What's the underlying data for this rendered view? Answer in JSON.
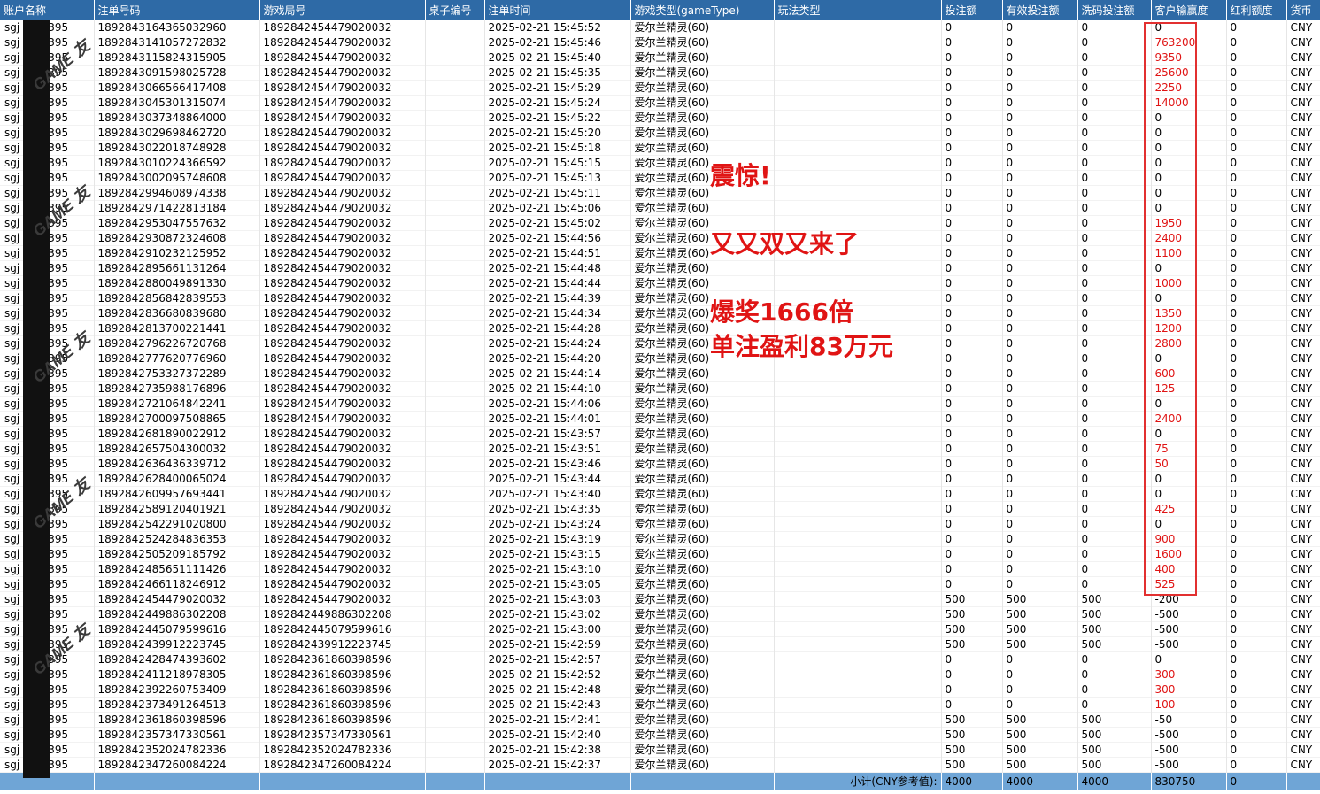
{
  "headers": [
    "账户名称",
    "注单号码",
    "游戏局号",
    "桌子编号",
    "注单时间",
    "游戏类型(gameType)",
    "玩法类型",
    "投注额",
    "有效投注额",
    "洗码投注额",
    "客户输赢度",
    "红利额度",
    "货币"
  ],
  "rows": [
    {
      "acct": "sgj",
      "acct_tail": "395",
      "bet_no": "1892843164365032960",
      "round": "1892842454479020032",
      "table": "",
      "time": "2025-02-21 15:45:52",
      "game": "爱尔兰精灵(60)",
      "play": "",
      "bet": "0",
      "valid": "0",
      "wash": "0",
      "win": "0",
      "bonus": "0",
      "cur": "CNY"
    },
    {
      "acct": "sgj",
      "acct_tail": "395",
      "bet_no": "1892843141057272832",
      "round": "1892842454479020032",
      "table": "",
      "time": "2025-02-21 15:45:46",
      "game": "爱尔兰精灵(60)",
      "play": "",
      "bet": "0",
      "valid": "0",
      "wash": "0",
      "win": "763200",
      "bonus": "0",
      "cur": "CNY"
    },
    {
      "acct": "sgj",
      "acct_tail": "395",
      "bet_no": "1892843115824315905",
      "round": "1892842454479020032",
      "table": "",
      "time": "2025-02-21 15:45:40",
      "game": "爱尔兰精灵(60)",
      "play": "",
      "bet": "0",
      "valid": "0",
      "wash": "0",
      "win": "9350",
      "bonus": "0",
      "cur": "CNY"
    },
    {
      "acct": "sgj",
      "acct_tail": "395",
      "bet_no": "1892843091598025728",
      "round": "1892842454479020032",
      "table": "",
      "time": "2025-02-21 15:45:35",
      "game": "爱尔兰精灵(60)",
      "play": "",
      "bet": "0",
      "valid": "0",
      "wash": "0",
      "win": "25600",
      "bonus": "0",
      "cur": "CNY"
    },
    {
      "acct": "sgj",
      "acct_tail": "395",
      "bet_no": "1892843066566417408",
      "round": "1892842454479020032",
      "table": "",
      "time": "2025-02-21 15:45:29",
      "game": "爱尔兰精灵(60)",
      "play": "",
      "bet": "0",
      "valid": "0",
      "wash": "0",
      "win": "2250",
      "bonus": "0",
      "cur": "CNY"
    },
    {
      "acct": "sgj",
      "acct_tail": "395",
      "bet_no": "1892843045301315074",
      "round": "1892842454479020032",
      "table": "",
      "time": "2025-02-21 15:45:24",
      "game": "爱尔兰精灵(60)",
      "play": "",
      "bet": "0",
      "valid": "0",
      "wash": "0",
      "win": "14000",
      "bonus": "0",
      "cur": "CNY"
    },
    {
      "acct": "sgj",
      "acct_tail": "395",
      "bet_no": "1892843037348864000",
      "round": "1892842454479020032",
      "table": "",
      "time": "2025-02-21 15:45:22",
      "game": "爱尔兰精灵(60)",
      "play": "",
      "bet": "0",
      "valid": "0",
      "wash": "0",
      "win": "0",
      "bonus": "0",
      "cur": "CNY"
    },
    {
      "acct": "sgj",
      "acct_tail": "395",
      "bet_no": "1892843029698462720",
      "round": "1892842454479020032",
      "table": "",
      "time": "2025-02-21 15:45:20",
      "game": "爱尔兰精灵(60)",
      "play": "",
      "bet": "0",
      "valid": "0",
      "wash": "0",
      "win": "0",
      "bonus": "0",
      "cur": "CNY"
    },
    {
      "acct": "sgj",
      "acct_tail": "395",
      "bet_no": "1892843022018748928",
      "round": "1892842454479020032",
      "table": "",
      "time": "2025-02-21 15:45:18",
      "game": "爱尔兰精灵(60)",
      "play": "",
      "bet": "0",
      "valid": "0",
      "wash": "0",
      "win": "0",
      "bonus": "0",
      "cur": "CNY"
    },
    {
      "acct": "sgj",
      "acct_tail": "395",
      "bet_no": "1892843010224366592",
      "round": "1892842454479020032",
      "table": "",
      "time": "2025-02-21 15:45:15",
      "game": "爱尔兰精灵(60)",
      "play": "",
      "bet": "0",
      "valid": "0",
      "wash": "0",
      "win": "0",
      "bonus": "0",
      "cur": "CNY"
    },
    {
      "acct": "sgj",
      "acct_tail": "395",
      "bet_no": "1892843002095748608",
      "round": "1892842454479020032",
      "table": "",
      "time": "2025-02-21 15:45:13",
      "game": "爱尔兰精灵(60)",
      "play": "",
      "bet": "0",
      "valid": "0",
      "wash": "0",
      "win": "0",
      "bonus": "0",
      "cur": "CNY"
    },
    {
      "acct": "sgj",
      "acct_tail": "395",
      "bet_no": "1892842994608974338",
      "round": "1892842454479020032",
      "table": "",
      "time": "2025-02-21 15:45:11",
      "game": "爱尔兰精灵(60)",
      "play": "",
      "bet": "0",
      "valid": "0",
      "wash": "0",
      "win": "0",
      "bonus": "0",
      "cur": "CNY"
    },
    {
      "acct": "sgj",
      "acct_tail": "395",
      "bet_no": "1892842971422813184",
      "round": "1892842454479020032",
      "table": "",
      "time": "2025-02-21 15:45:06",
      "game": "爱尔兰精灵(60)",
      "play": "",
      "bet": "0",
      "valid": "0",
      "wash": "0",
      "win": "0",
      "bonus": "0",
      "cur": "CNY"
    },
    {
      "acct": "sgj",
      "acct_tail": "395",
      "bet_no": "1892842953047557632",
      "round": "1892842454479020032",
      "table": "",
      "time": "2025-02-21 15:45:02",
      "game": "爱尔兰精灵(60)",
      "play": "",
      "bet": "0",
      "valid": "0",
      "wash": "0",
      "win": "1950",
      "bonus": "0",
      "cur": "CNY"
    },
    {
      "acct": "sgj",
      "acct_tail": "395",
      "bet_no": "1892842930872324608",
      "round": "1892842454479020032",
      "table": "",
      "time": "2025-02-21 15:44:56",
      "game": "爱尔兰精灵(60)",
      "play": "",
      "bet": "0",
      "valid": "0",
      "wash": "0",
      "win": "2400",
      "bonus": "0",
      "cur": "CNY"
    },
    {
      "acct": "sgj",
      "acct_tail": "395",
      "bet_no": "1892842910232125952",
      "round": "1892842454479020032",
      "table": "",
      "time": "2025-02-21 15:44:51",
      "game": "爱尔兰精灵(60)",
      "play": "",
      "bet": "0",
      "valid": "0",
      "wash": "0",
      "win": "1100",
      "bonus": "0",
      "cur": "CNY"
    },
    {
      "acct": "sgj",
      "acct_tail": "395",
      "bet_no": "1892842895661131264",
      "round": "1892842454479020032",
      "table": "",
      "time": "2025-02-21 15:44:48",
      "game": "爱尔兰精灵(60)",
      "play": "",
      "bet": "0",
      "valid": "0",
      "wash": "0",
      "win": "0",
      "bonus": "0",
      "cur": "CNY"
    },
    {
      "acct": "sgj",
      "acct_tail": "395",
      "bet_no": "1892842880049891330",
      "round": "1892842454479020032",
      "table": "",
      "time": "2025-02-21 15:44:44",
      "game": "爱尔兰精灵(60)",
      "play": "",
      "bet": "0",
      "valid": "0",
      "wash": "0",
      "win": "1000",
      "bonus": "0",
      "cur": "CNY"
    },
    {
      "acct": "sgj",
      "acct_tail": "395",
      "bet_no": "1892842856842839553",
      "round": "1892842454479020032",
      "table": "",
      "time": "2025-02-21 15:44:39",
      "game": "爱尔兰精灵(60)",
      "play": "",
      "bet": "0",
      "valid": "0",
      "wash": "0",
      "win": "0",
      "bonus": "0",
      "cur": "CNY"
    },
    {
      "acct": "sgj",
      "acct_tail": "395",
      "bet_no": "1892842836680839680",
      "round": "1892842454479020032",
      "table": "",
      "time": "2025-02-21 15:44:34",
      "game": "爱尔兰精灵(60)",
      "play": "",
      "bet": "0",
      "valid": "0",
      "wash": "0",
      "win": "1350",
      "bonus": "0",
      "cur": "CNY"
    },
    {
      "acct": "sgj",
      "acct_tail": "395",
      "bet_no": "1892842813700221441",
      "round": "1892842454479020032",
      "table": "",
      "time": "2025-02-21 15:44:28",
      "game": "爱尔兰精灵(60)",
      "play": "",
      "bet": "0",
      "valid": "0",
      "wash": "0",
      "win": "1200",
      "bonus": "0",
      "cur": "CNY"
    },
    {
      "acct": "sgj",
      "acct_tail": "395",
      "bet_no": "1892842796226720768",
      "round": "1892842454479020032",
      "table": "",
      "time": "2025-02-21 15:44:24",
      "game": "爱尔兰精灵(60)",
      "play": "",
      "bet": "0",
      "valid": "0",
      "wash": "0",
      "win": "2800",
      "bonus": "0",
      "cur": "CNY"
    },
    {
      "acct": "sgj",
      "acct_tail": "395",
      "bet_no": "1892842777620776960",
      "round": "1892842454479020032",
      "table": "",
      "time": "2025-02-21 15:44:20",
      "game": "爱尔兰精灵(60)",
      "play": "",
      "bet": "0",
      "valid": "0",
      "wash": "0",
      "win": "0",
      "bonus": "0",
      "cur": "CNY"
    },
    {
      "acct": "sgj",
      "acct_tail": "395",
      "bet_no": "1892842753327372289",
      "round": "1892842454479020032",
      "table": "",
      "time": "2025-02-21 15:44:14",
      "game": "爱尔兰精灵(60)",
      "play": "",
      "bet": "0",
      "valid": "0",
      "wash": "0",
      "win": "600",
      "bonus": "0",
      "cur": "CNY"
    },
    {
      "acct": "sgj",
      "acct_tail": "395",
      "bet_no": "1892842735988176896",
      "round": "1892842454479020032",
      "table": "",
      "time": "2025-02-21 15:44:10",
      "game": "爱尔兰精灵(60)",
      "play": "",
      "bet": "0",
      "valid": "0",
      "wash": "0",
      "win": "125",
      "bonus": "0",
      "cur": "CNY"
    },
    {
      "acct": "sgj",
      "acct_tail": "395",
      "bet_no": "1892842721064842241",
      "round": "1892842454479020032",
      "table": "",
      "time": "2025-02-21 15:44:06",
      "game": "爱尔兰精灵(60)",
      "play": "",
      "bet": "0",
      "valid": "0",
      "wash": "0",
      "win": "0",
      "bonus": "0",
      "cur": "CNY"
    },
    {
      "acct": "sgj",
      "acct_tail": "395",
      "bet_no": "1892842700097508865",
      "round": "1892842454479020032",
      "table": "",
      "time": "2025-02-21 15:44:01",
      "game": "爱尔兰精灵(60)",
      "play": "",
      "bet": "0",
      "valid": "0",
      "wash": "0",
      "win": "2400",
      "bonus": "0",
      "cur": "CNY"
    },
    {
      "acct": "sgj",
      "acct_tail": "395",
      "bet_no": "1892842681890022912",
      "round": "1892842454479020032",
      "table": "",
      "time": "2025-02-21 15:43:57",
      "game": "爱尔兰精灵(60)",
      "play": "",
      "bet": "0",
      "valid": "0",
      "wash": "0",
      "win": "0",
      "bonus": "0",
      "cur": "CNY"
    },
    {
      "acct": "sgj",
      "acct_tail": "395",
      "bet_no": "1892842657504300032",
      "round": "1892842454479020032",
      "table": "",
      "time": "2025-02-21 15:43:51",
      "game": "爱尔兰精灵(60)",
      "play": "",
      "bet": "0",
      "valid": "0",
      "wash": "0",
      "win": "75",
      "bonus": "0",
      "cur": "CNY"
    },
    {
      "acct": "sgj",
      "acct_tail": "395",
      "bet_no": "1892842636436339712",
      "round": "1892842454479020032",
      "table": "",
      "time": "2025-02-21 15:43:46",
      "game": "爱尔兰精灵(60)",
      "play": "",
      "bet": "0",
      "valid": "0",
      "wash": "0",
      "win": "50",
      "bonus": "0",
      "cur": "CNY"
    },
    {
      "acct": "sgj",
      "acct_tail": "395",
      "bet_no": "1892842628400065024",
      "round": "1892842454479020032",
      "table": "",
      "time": "2025-02-21 15:43:44",
      "game": "爱尔兰精灵(60)",
      "play": "",
      "bet": "0",
      "valid": "0",
      "wash": "0",
      "win": "0",
      "bonus": "0",
      "cur": "CNY"
    },
    {
      "acct": "sgj",
      "acct_tail": "395",
      "bet_no": "1892842609957693441",
      "round": "1892842454479020032",
      "table": "",
      "time": "2025-02-21 15:43:40",
      "game": "爱尔兰精灵(60)",
      "play": "",
      "bet": "0",
      "valid": "0",
      "wash": "0",
      "win": "0",
      "bonus": "0",
      "cur": "CNY"
    },
    {
      "acct": "sgj",
      "acct_tail": "395",
      "bet_no": "1892842589120401921",
      "round": "1892842454479020032",
      "table": "",
      "time": "2025-02-21 15:43:35",
      "game": "爱尔兰精灵(60)",
      "play": "",
      "bet": "0",
      "valid": "0",
      "wash": "0",
      "win": "425",
      "bonus": "0",
      "cur": "CNY"
    },
    {
      "acct": "sgj",
      "acct_tail": "395",
      "bet_no": "1892842542291020800",
      "round": "1892842454479020032",
      "table": "",
      "time": "2025-02-21 15:43:24",
      "game": "爱尔兰精灵(60)",
      "play": "",
      "bet": "0",
      "valid": "0",
      "wash": "0",
      "win": "0",
      "bonus": "0",
      "cur": "CNY"
    },
    {
      "acct": "sgj",
      "acct_tail": "395",
      "bet_no": "1892842524284836353",
      "round": "1892842454479020032",
      "table": "",
      "time": "2025-02-21 15:43:19",
      "game": "爱尔兰精灵(60)",
      "play": "",
      "bet": "0",
      "valid": "0",
      "wash": "0",
      "win": "900",
      "bonus": "0",
      "cur": "CNY"
    },
    {
      "acct": "sgj",
      "acct_tail": "395",
      "bet_no": "1892842505209185792",
      "round": "1892842454479020032",
      "table": "",
      "time": "2025-02-21 15:43:15",
      "game": "爱尔兰精灵(60)",
      "play": "",
      "bet": "0",
      "valid": "0",
      "wash": "0",
      "win": "1600",
      "bonus": "0",
      "cur": "CNY"
    },
    {
      "acct": "sgj",
      "acct_tail": "395",
      "bet_no": "1892842485651111426",
      "round": "1892842454479020032",
      "table": "",
      "time": "2025-02-21 15:43:10",
      "game": "爱尔兰精灵(60)",
      "play": "",
      "bet": "0",
      "valid": "0",
      "wash": "0",
      "win": "400",
      "bonus": "0",
      "cur": "CNY"
    },
    {
      "acct": "sgj",
      "acct_tail": "395",
      "bet_no": "1892842466118246912",
      "round": "1892842454479020032",
      "table": "",
      "time": "2025-02-21 15:43:05",
      "game": "爱尔兰精灵(60)",
      "play": "",
      "bet": "0",
      "valid": "0",
      "wash": "0",
      "win": "525",
      "bonus": "0",
      "cur": "CNY"
    },
    {
      "acct": "sgj",
      "acct_tail": "395",
      "bet_no": "1892842454479020032",
      "round": "1892842454479020032",
      "table": "",
      "time": "2025-02-21 15:43:03",
      "game": "爱尔兰精灵(60)",
      "play": "",
      "bet": "500",
      "valid": "500",
      "wash": "500",
      "win": "-200",
      "bonus": "0",
      "cur": "CNY"
    },
    {
      "acct": "sgj",
      "acct_tail": "395",
      "bet_no": "1892842449886302208",
      "round": "1892842449886302208",
      "table": "",
      "time": "2025-02-21 15:43:02",
      "game": "爱尔兰精灵(60)",
      "play": "",
      "bet": "500",
      "valid": "500",
      "wash": "500",
      "win": "-500",
      "bonus": "0",
      "cur": "CNY"
    },
    {
      "acct": "sgj",
      "acct_tail": "395",
      "bet_no": "1892842445079599616",
      "round": "1892842445079599616",
      "table": "",
      "time": "2025-02-21 15:43:00",
      "game": "爱尔兰精灵(60)",
      "play": "",
      "bet": "500",
      "valid": "500",
      "wash": "500",
      "win": "-500",
      "bonus": "0",
      "cur": "CNY"
    },
    {
      "acct": "sgj",
      "acct_tail": "395",
      "bet_no": "1892842439912223745",
      "round": "1892842439912223745",
      "table": "",
      "time": "2025-02-21 15:42:59",
      "game": "爱尔兰精灵(60)",
      "play": "",
      "bet": "500",
      "valid": "500",
      "wash": "500",
      "win": "-500",
      "bonus": "0",
      "cur": "CNY"
    },
    {
      "acct": "sgj",
      "acct_tail": "395",
      "bet_no": "1892842428474393602",
      "round": "1892842361860398596",
      "table": "",
      "time": "2025-02-21 15:42:57",
      "game": "爱尔兰精灵(60)",
      "play": "",
      "bet": "0",
      "valid": "0",
      "wash": "0",
      "win": "0",
      "bonus": "0",
      "cur": "CNY"
    },
    {
      "acct": "sgj",
      "acct_tail": "395",
      "bet_no": "1892842411218978305",
      "round": "1892842361860398596",
      "table": "",
      "time": "2025-02-21 15:42:52",
      "game": "爱尔兰精灵(60)",
      "play": "",
      "bet": "0",
      "valid": "0",
      "wash": "0",
      "win": "300",
      "bonus": "0",
      "cur": "CNY"
    },
    {
      "acct": "sgj",
      "acct_tail": "395",
      "bet_no": "1892842392260753409",
      "round": "1892842361860398596",
      "table": "",
      "time": "2025-02-21 15:42:48",
      "game": "爱尔兰精灵(60)",
      "play": "",
      "bet": "0",
      "valid": "0",
      "wash": "0",
      "win": "300",
      "bonus": "0",
      "cur": "CNY"
    },
    {
      "acct": "sgj",
      "acct_tail": "395",
      "bet_no": "1892842373491264513",
      "round": "1892842361860398596",
      "table": "",
      "time": "2025-02-21 15:42:43",
      "game": "爱尔兰精灵(60)",
      "play": "",
      "bet": "0",
      "valid": "0",
      "wash": "0",
      "win": "100",
      "bonus": "0",
      "cur": "CNY"
    },
    {
      "acct": "sgj",
      "acct_tail": "395",
      "bet_no": "1892842361860398596",
      "round": "1892842361860398596",
      "table": "",
      "time": "2025-02-21 15:42:41",
      "game": "爱尔兰精灵(60)",
      "play": "",
      "bet": "500",
      "valid": "500",
      "wash": "500",
      "win": "-50",
      "bonus": "0",
      "cur": "CNY"
    },
    {
      "acct": "sgj",
      "acct_tail": "395",
      "bet_no": "1892842357347330561",
      "round": "1892842357347330561",
      "table": "",
      "time": "2025-02-21 15:42:40",
      "game": "爱尔兰精灵(60)",
      "play": "",
      "bet": "500",
      "valid": "500",
      "wash": "500",
      "win": "-500",
      "bonus": "0",
      "cur": "CNY"
    },
    {
      "acct": "sgj",
      "acct_tail": "395",
      "bet_no": "1892842352024782336",
      "round": "1892842352024782336",
      "table": "",
      "time": "2025-02-21 15:42:38",
      "game": "爱尔兰精灵(60)",
      "play": "",
      "bet": "500",
      "valid": "500",
      "wash": "500",
      "win": "-500",
      "bonus": "0",
      "cur": "CNY"
    },
    {
      "acct": "sgj",
      "acct_tail": "395",
      "bet_no": "1892842347260084224",
      "round": "1892842347260084224",
      "table": "",
      "time": "2025-02-21 15:42:37",
      "game": "爱尔兰精灵(60)",
      "play": "",
      "bet": "500",
      "valid": "500",
      "wash": "500",
      "win": "-500",
      "bonus": "0",
      "cur": "CNY"
    }
  ],
  "footer": {
    "label": "小计(CNY参考值):",
    "bet": "4000",
    "valid": "4000",
    "wash": "4000",
    "win": "830750",
    "bonus": "0"
  },
  "watermark": [
    "GAME 友",
    "GAME 友",
    "GAME 友",
    "GAME 友",
    "GAME 友"
  ],
  "annotations": [
    "震惊!",
    "又又双又来了",
    "爆奖1666倍",
    "单注盈利83万元"
  ],
  "colors": {
    "header_bg": "#2e6aa6",
    "footer_bg": "#6fa5d6",
    "highlight_red": "#e01414"
  }
}
